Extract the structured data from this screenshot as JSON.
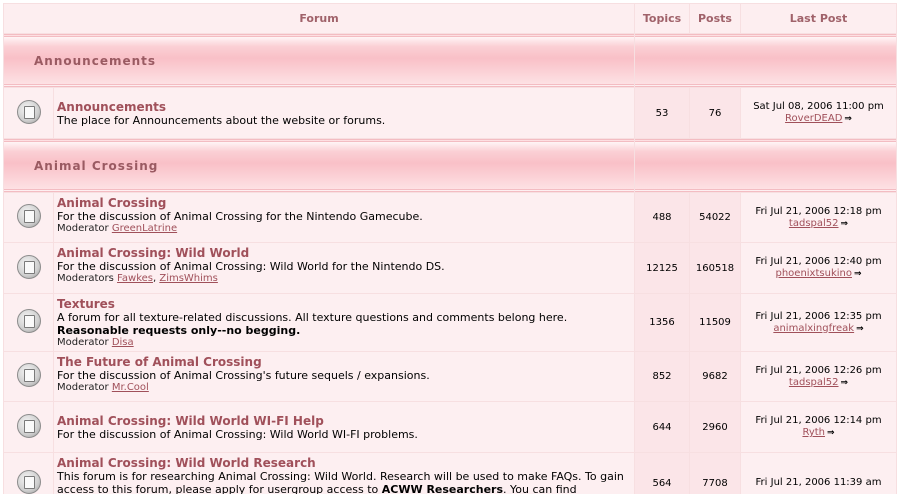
{
  "header": {
    "forum": "Forum",
    "topics": "Topics",
    "posts": "Posts",
    "last_post": "Last Post"
  },
  "categories": [
    {
      "title": "Announcements"
    },
    {
      "title": "Animal Crossing"
    }
  ],
  "forums": [
    {
      "name": "Announcements",
      "desc": "The place for Announcements about the website or forums.",
      "topics": "53",
      "posts": "76",
      "last_date": "Sat Jul 08, 2006 11:00 pm",
      "last_user": "RoverDEAD"
    },
    {
      "name": "Animal Crossing",
      "desc": "For the discussion of Animal Crossing for the Nintendo Gamecube.",
      "mod_label": "Moderator",
      "mods": [
        "GreenLatrine"
      ],
      "topics": "488",
      "posts": "54022",
      "last_date": "Fri Jul 21, 2006 12:18 pm",
      "last_user": "tadspal52"
    },
    {
      "name": "Animal Crossing: Wild World",
      "desc": "For the discussion of Animal Crossing: Wild World for the Nintendo DS.",
      "mod_label": "Moderators",
      "mods": [
        "Fawkes",
        "ZimsWhims"
      ],
      "topics": "12125",
      "posts": "160518",
      "last_date": "Fri Jul 21, 2006 12:40 pm",
      "last_user": "phoenixtsukino"
    },
    {
      "name": "Textures",
      "desc": "A forum for all texture-related discussions. All texture questions and comments belong here.",
      "bold": "Reasonable requests only--no begging.",
      "mod_label": "Moderator",
      "mods": [
        "Disa"
      ],
      "topics": "1356",
      "posts": "11509",
      "last_date": "Fri Jul 21, 2006 12:35 pm",
      "last_user": "animalxingfreak"
    },
    {
      "name": "The Future of Animal Crossing",
      "desc": "For the discussion of Animal Crossing's future sequels / expansions.",
      "mod_label": "Moderator",
      "mods": [
        "Mr.Cool"
      ],
      "topics": "852",
      "posts": "9682",
      "last_date": "Fri Jul 21, 2006 12:26 pm",
      "last_user": "tadspal52"
    },
    {
      "name": "Animal Crossing: Wild World WI-FI Help",
      "desc": "For the discussion of Animal Crossing: Wild World WI-FI problems.",
      "topics": "644",
      "posts": "2960",
      "last_date": "Fri Jul 21, 2006 12:14 pm",
      "last_user": "Ryth"
    },
    {
      "name": "Animal Crossing: Wild World Research",
      "desc": "This forum is for researching Animal Crossing: Wild World. Research will be used to make FAQs. To gain access to this forum, please apply for usergroup access to",
      "desc_bold": "ACWW Researchers",
      "desc_tail": ". You can find",
      "topics": "564",
      "posts": "7708",
      "last_date": "Fri Jul 21, 2006 11:39 am",
      "last_user": ""
    }
  ],
  "icons": {
    "forum": "folder-icon",
    "goto": "arrow-icon"
  }
}
